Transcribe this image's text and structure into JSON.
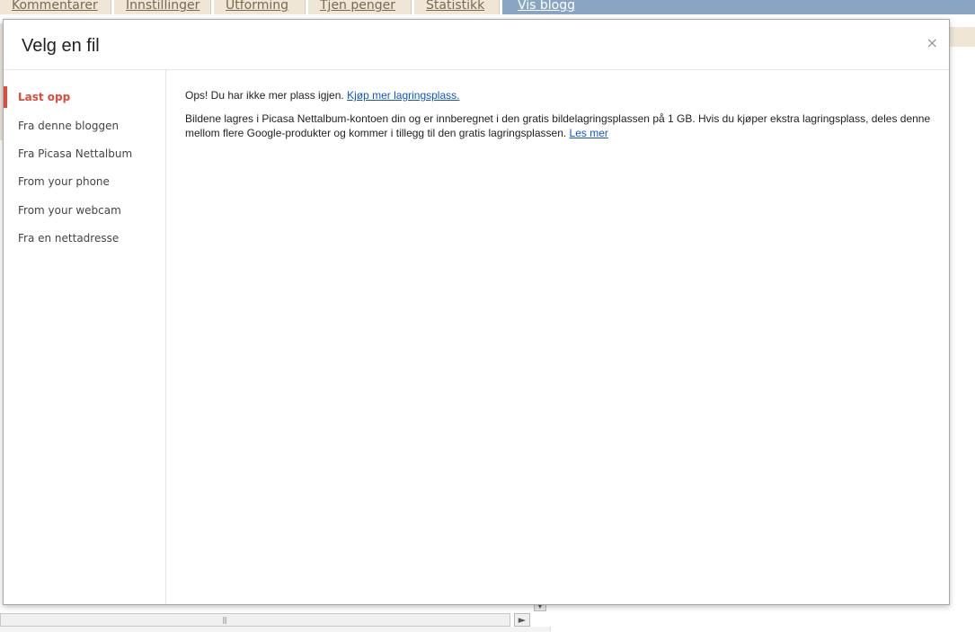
{
  "background": {
    "tabs": [
      {
        "label": "Kommentarer"
      },
      {
        "label": "Innstillinger"
      },
      {
        "label": "Utforming"
      },
      {
        "label": "Tjen penger"
      },
      {
        "label": "Statistikk"
      },
      {
        "label": "Vis blogg"
      }
    ]
  },
  "dialog": {
    "title": "Velg en fil",
    "close_label": "×",
    "nav": [
      {
        "label": "Last opp",
        "active": true
      },
      {
        "label": "Fra denne bloggen"
      },
      {
        "label": "Fra Picasa Nettalbum"
      },
      {
        "label": "From your phone"
      },
      {
        "label": "From your webcam"
      },
      {
        "label": "Fra en nettadresse"
      }
    ],
    "message": {
      "text": "Ops! Du har ikke mer plass igjen.",
      "link": "Kjøp mer lagringsplass."
    },
    "info": {
      "text": "Bildene lagres i Picasa Nettalbum-kontoen din og er innberegnet i den gratis bildelagringsplassen på 1 GB. Hvis du kjøper ekstra lagringsplass, deles denne mellom flere Google-produkter og kommer i tillegg til den gratis lagringsplassen.",
      "link": "Les mer"
    }
  },
  "colors": {
    "accent": "#dd4b39",
    "link": "#1155cc",
    "active_tab": "#8aa5c4"
  }
}
